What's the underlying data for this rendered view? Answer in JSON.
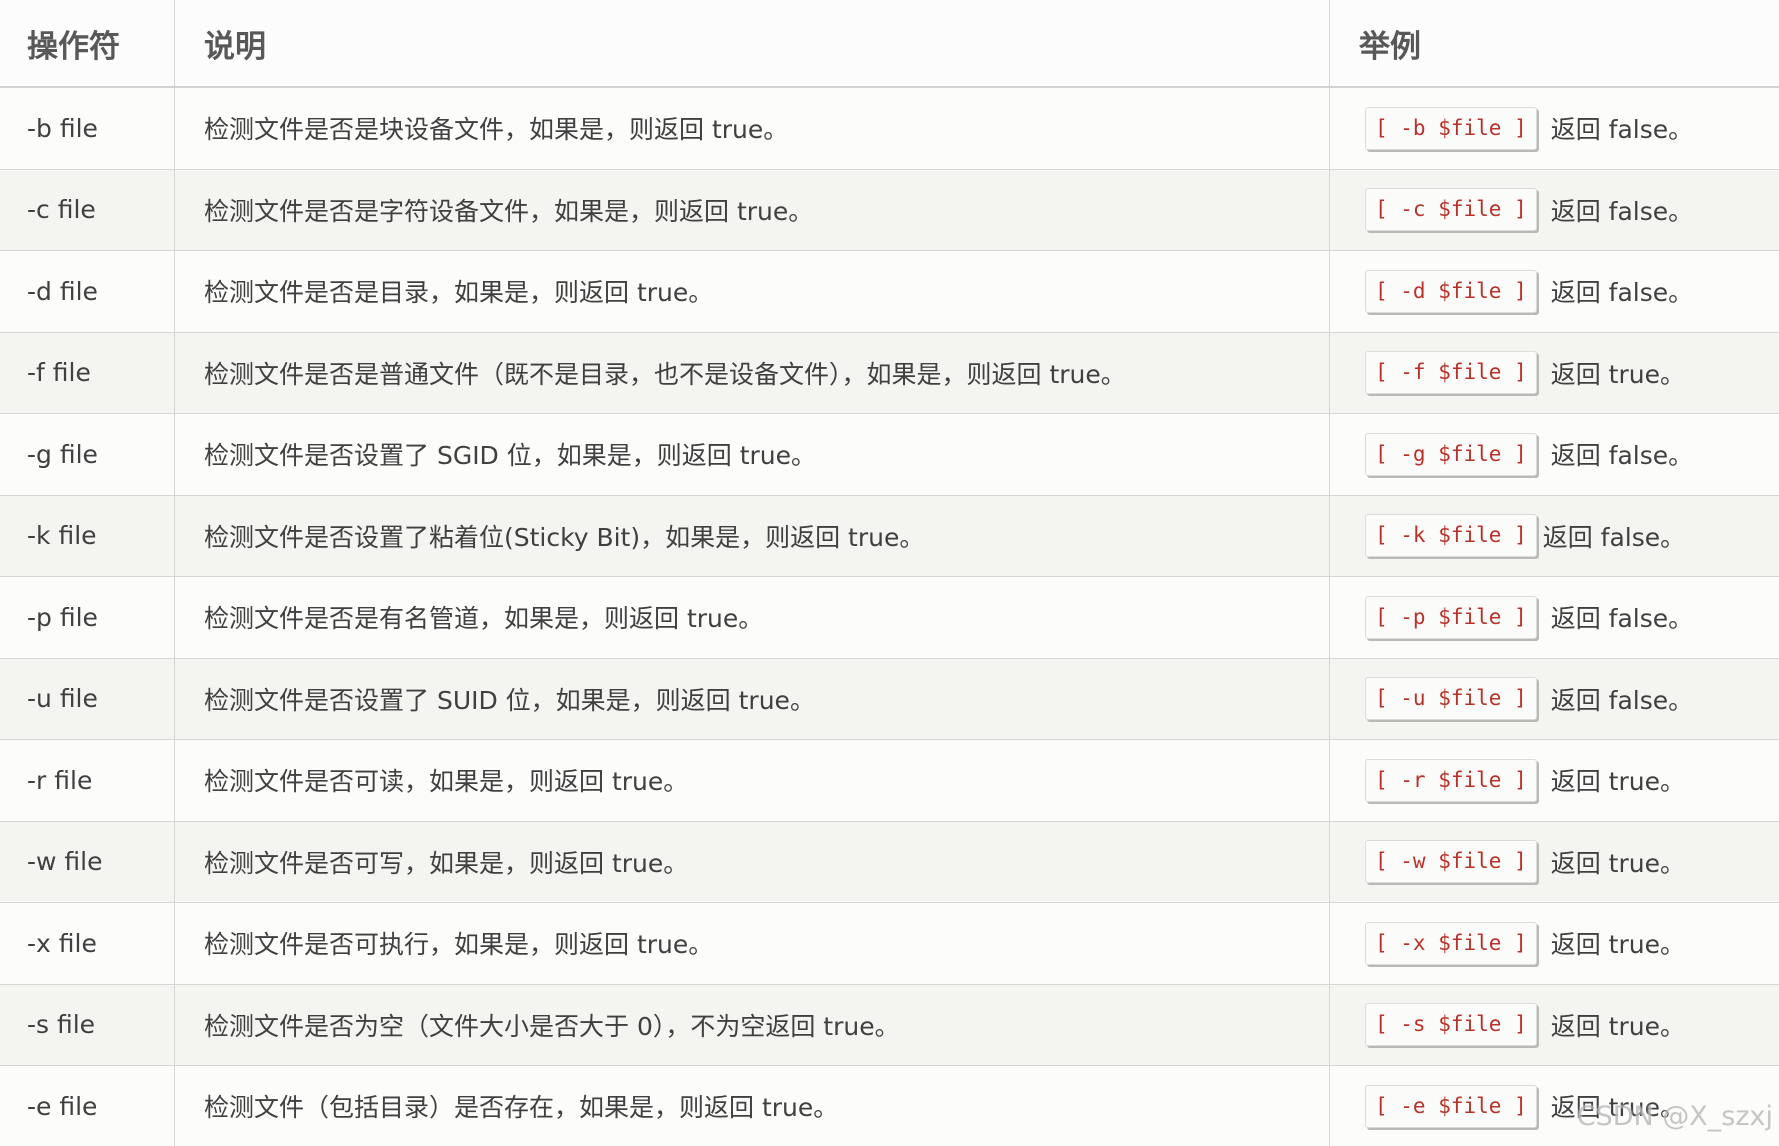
{
  "table": {
    "headers": {
      "operator": "操作符",
      "description": "说明",
      "example": "举例"
    },
    "rows": [
      {
        "operator": "-b file",
        "description": "检测文件是否是块设备文件，如果是，则返回 true。",
        "code": "[ -b $file ]",
        "result": "返回 false。"
      },
      {
        "operator": "-c file",
        "description": "检测文件是否是字符设备文件，如果是，则返回 true。",
        "code": "[ -c $file ]",
        "result": "返回 false。"
      },
      {
        "operator": "-d file",
        "description": "检测文件是否是目录，如果是，则返回 true。",
        "code": "[ -d $file ]",
        "result": "返回 false。"
      },
      {
        "operator": "-f file",
        "description": "检测文件是否是普通文件（既不是目录，也不是设备文件），如果是，则返回 true。",
        "code": "[ -f $file ]",
        "result": "返回 true。"
      },
      {
        "operator": "-g file",
        "description": "检测文件是否设置了 SGID 位，如果是，则返回 true。",
        "code": "[ -g $file ]",
        "result": "返回 false。"
      },
      {
        "operator": "-k file",
        "description": "检测文件是否设置了粘着位(Sticky Bit)，如果是，则返回 true。",
        "code": "[ -k $file ]",
        "result": "返回 false。"
      },
      {
        "operator": "-p file",
        "description": "检测文件是否是有名管道，如果是，则返回 true。",
        "code": "[ -p $file ]",
        "result": "返回 false。"
      },
      {
        "operator": "-u file",
        "description": "检测文件是否设置了 SUID 位，如果是，则返回 true。",
        "code": "[ -u $file ]",
        "result": "返回 false。"
      },
      {
        "operator": "-r file",
        "description": "检测文件是否可读，如果是，则返回 true。",
        "code": "[ -r $file ]",
        "result": "返回 true。"
      },
      {
        "operator": "-w file",
        "description": "检测文件是否可写，如果是，则返回 true。",
        "code": "[ -w $file ]",
        "result": "返回 true。"
      },
      {
        "operator": "-x file",
        "description": "检测文件是否可执行，如果是，则返回 true。",
        "code": "[ -x $file ]",
        "result": "返回 true。"
      },
      {
        "operator": "-s file",
        "description": "检测文件是否为空（文件大小是否大于 0），不为空返回 true。",
        "code": "[ -s $file ]",
        "result": "返回 true。"
      },
      {
        "operator": "-e file",
        "description": "检测文件（包括目录）是否存在，如果是，则返回 true。",
        "code": "[ -e $file ]",
        "result": "返回 true。"
      }
    ]
  },
  "watermark": "CSDN @X_szxj"
}
